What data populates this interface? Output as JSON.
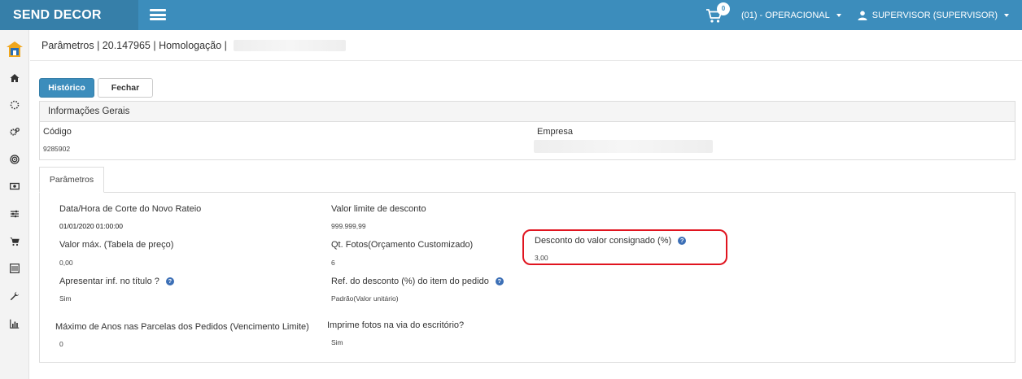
{
  "app": {
    "brand": "SEND DECOR"
  },
  "topbar": {
    "cart_count": "0",
    "company": "(01) - OPERACIONAL",
    "user": "SUPERVISOR (SUPERVISOR)"
  },
  "header": {
    "breadcrumb": "Parâmetros | 20.147965 | Homologação |"
  },
  "buttons": {
    "history": "Histórico",
    "close": "Fechar"
  },
  "general": {
    "title": "Informações Gerais",
    "code_label": "Código",
    "code_value": "9285902",
    "company_label": "Empresa"
  },
  "tabs": [
    {
      "label": "Parâmetros"
    }
  ],
  "params": {
    "cutoff_label": "Data/Hora de Corte do Novo Rateio",
    "cutoff_value": "01/01/2020 01:00:00",
    "discount_limit_label": "Valor limite de desconto",
    "discount_limit_value": "999.999,99",
    "max_value_label": "Valor máx. (Tabela de preço)",
    "max_value_value": "0,00",
    "photos_label": "Qt. Fotos(Orçamento Customizado)",
    "photos_value": "6",
    "consigned_label": "Desconto do valor consignado (%)",
    "consigned_value": "3,00",
    "show_title_label": "Apresentar inf. no título ?",
    "show_title_value": "Sim",
    "discount_ref_label": "Ref. do desconto (%) do item do pedido",
    "discount_ref_value": "Padrão(Valor unitário)",
    "max_years_label": "Máximo de Anos nas Parcelas dos Pedidos (Vencimento Limite)",
    "max_years_value": "0",
    "print_photos_label": "Imprime fotos na via do escritório?",
    "print_photos_value": "Sim"
  },
  "colors": {
    "topbar": "#3c8dbc",
    "brand_bg": "#367fa9",
    "highlight": "#e0141f",
    "help_icon": "#3c6fb6"
  },
  "icons": [
    "menu-icon",
    "cart-icon",
    "user-icon",
    "home-icon",
    "spinner-icon",
    "cogs-icon",
    "target-icon",
    "money-icon",
    "sliders-icon",
    "cart-icon",
    "barcode-icon",
    "wrench-icon",
    "bar-chart-icon",
    "help-icon"
  ]
}
